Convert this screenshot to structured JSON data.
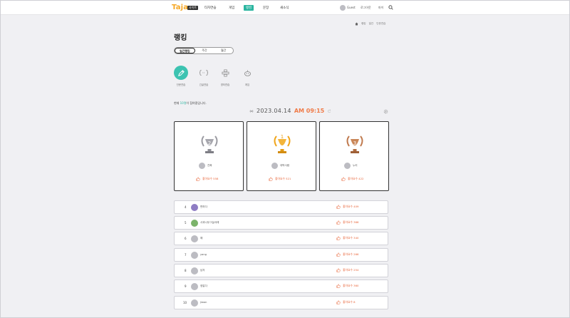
{
  "header": {
    "logo": "Taja",
    "logo_badge": "사이트",
    "nav": [
      {
        "label": "타자연습"
      },
      {
        "label": "게임"
      },
      {
        "label": "랭킹"
      },
      {
        "label": "문장"
      },
      {
        "label": "새소식"
      }
    ],
    "user_name": "Guest",
    "links": [
      "로그아웃",
      "마이"
    ]
  },
  "breadcrumb": [
    "랭킹",
    "일간",
    "단문연습"
  ],
  "page_title": "랭킹",
  "tabs": [
    {
      "label": "일간랭킹"
    },
    {
      "label": "주간"
    },
    {
      "label": "월간"
    }
  ],
  "categories": [
    {
      "label": "단문연습",
      "icon": "pen-icon"
    },
    {
      "label": "긴글연습",
      "icon": "bracket-icon"
    },
    {
      "label": "영타연습",
      "icon": "keyboard-icon"
    },
    {
      "label": "게임",
      "icon": "game-icon"
    }
  ],
  "notice": {
    "prefix": "현재 ",
    "highlight": "10명",
    "suffix": "이 참여중입니다."
  },
  "date": {
    "date": "2023.04.14",
    "time": "AM 09:15"
  },
  "podium": [
    {
      "rank": "2",
      "name": "진짜",
      "likes": "좋아요수 558"
    },
    {
      "rank": "1",
      "name": "대박사람",
      "likes": "좋아요수 521"
    },
    {
      "rank": "3",
      "name": "누리",
      "likes": "좋아요수 422"
    }
  ],
  "rows": [
    {
      "rank": "4",
      "name": "변하다",
      "likes": "좋아요수 409"
    },
    {
      "rank": "5",
      "name": "사과나무그늘아래",
      "likes": "좋아요수 366"
    },
    {
      "rank": "6",
      "name": "해",
      "likes": "좋아요수 340"
    },
    {
      "rank": "7",
      "name": "yang",
      "likes": "좋아요수 266"
    },
    {
      "rank": "8",
      "name": "남자",
      "likes": "좋아요수 254"
    },
    {
      "rank": "9",
      "name": "정말다",
      "likes": "좋아요수 360"
    },
    {
      "rank": "10",
      "name": "jiwon",
      "likes": "좋아요수 8"
    }
  ],
  "colors": {
    "accent": "#2bb5a0",
    "like": "#e8653a",
    "time": "#f07b48",
    "gold": "#f0a51c",
    "silver": "#9c9ca3",
    "bronze": "#c07a4e"
  }
}
